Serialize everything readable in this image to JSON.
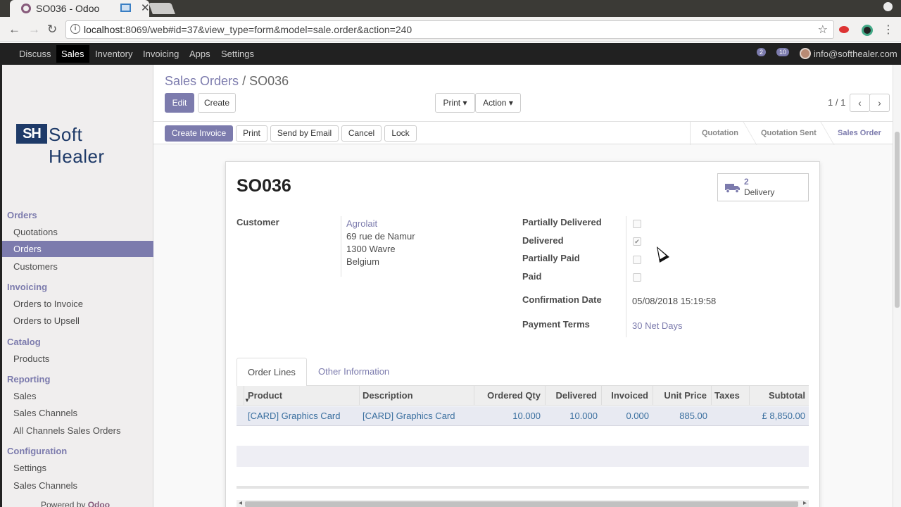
{
  "browser": {
    "tab_title": "SO036 - Odoo",
    "url_host": "localhost",
    "url_rest": ":8069/web#id=37&view_type=form&model=sale.order&action=240"
  },
  "topmenu": {
    "items": [
      "Discuss",
      "Sales",
      "Inventory",
      "Invoicing",
      "Apps",
      "Settings"
    ],
    "active": "Sales",
    "chat_badge": "2",
    "msg_badge": "10",
    "user_email": "info@softhealer.com"
  },
  "sidebar": {
    "logo_mark": "SH",
    "logo_word": "Soft Healer",
    "sections": [
      {
        "title": "Orders",
        "items": [
          "Quotations",
          "Orders",
          "Customers"
        ]
      },
      {
        "title": "Invoicing",
        "items": [
          "Orders to Invoice",
          "Orders to Upsell"
        ]
      },
      {
        "title": "Catalog",
        "items": [
          "Products"
        ]
      },
      {
        "title": "Reporting",
        "items": [
          "Sales",
          "Sales Channels",
          "All Channels Sales Orders"
        ]
      },
      {
        "title": "Configuration",
        "items": [
          "Settings",
          "Sales Channels"
        ]
      }
    ],
    "active_item": "Orders",
    "powered_by": "Powered by",
    "powered_brand": "Odoo"
  },
  "control_panel": {
    "breadcrumb_parent": "Sales Orders",
    "breadcrumb_sep": "/",
    "breadcrumb_current": "SO036",
    "edit_label": "Edit",
    "create_label": "Create",
    "print_label": "Print",
    "action_label": "Action",
    "pager": "1 / 1"
  },
  "header_buttons": {
    "create_invoice": "Create Invoice",
    "print": "Print",
    "send_email": "Send by Email",
    "cancel": "Cancel",
    "lock": "Lock"
  },
  "status": {
    "steps": [
      "Quotation",
      "Quotation Sent",
      "Sales Order"
    ],
    "active": "Sales Order"
  },
  "form": {
    "name": "SO036",
    "smart_button": {
      "count": "2",
      "label": "Delivery",
      "icon": "truck-icon"
    },
    "customer_label": "Customer",
    "customer_name": "Agrolait",
    "address_line1": "69 rue de Namur",
    "address_line2": "1300 Wavre",
    "address_line3": "Belgium",
    "flags": [
      {
        "label": "Partially Delivered",
        "checked": false
      },
      {
        "label": "Delivered",
        "checked": true
      },
      {
        "label": "Partially Paid",
        "checked": false
      },
      {
        "label": "Paid",
        "checked": false
      }
    ],
    "confirmation_date_label": "Confirmation Date",
    "confirmation_date": "05/08/2018 15:19:58",
    "payment_terms_label": "Payment Terms",
    "payment_terms": "30 Net Days"
  },
  "tabs": [
    "Order Lines",
    "Other Information"
  ],
  "order_lines": {
    "columns": [
      "Product",
      "Description",
      "Ordered Qty",
      "Delivered",
      "Invoiced",
      "Unit Price",
      "Taxes",
      "Subtotal"
    ],
    "rows": [
      {
        "product": "[CARD] Graphics Card",
        "description": "[CARD] Graphics Card",
        "ordered_qty": "10.000",
        "delivered": "10.000",
        "invoiced": "0.000",
        "unit_price": "885.00",
        "taxes": "",
        "subtotal": "£ 8,850.00"
      }
    ]
  }
}
